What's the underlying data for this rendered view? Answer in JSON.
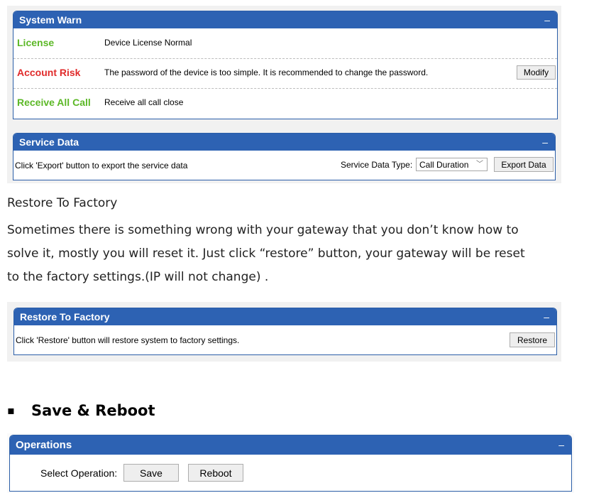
{
  "system_warn": {
    "title": "System Warn",
    "collapse": "–",
    "rows": [
      {
        "label": "License",
        "text": "Device License Normal",
        "color": "#5cb827"
      },
      {
        "label": "Account Risk",
        "text": "The password of the device is too simple. It is recommended to change the password.",
        "color": "#e02b2b",
        "button": "Modify"
      },
      {
        "label": "Receive All Call",
        "text": "Receive all call close",
        "color": "#5cb827"
      }
    ]
  },
  "service_data": {
    "title": "Service Data",
    "collapse": "–",
    "description": "Click 'Export' button to export the service data",
    "type_label": "Service Data Type:",
    "type_value": "Call Duration",
    "export_button": "Export Data"
  },
  "doc": {
    "heading": "Restore To Factory",
    "paragraph_lines": [
      "Sometimes there is something wrong with your gateway that you don’t know how to",
      "solve it, mostly you will reset it. Just click “restore” button, your gateway will be reset",
      "to the factory settings.(IP will not change) ."
    ],
    "section_bullet": "▪",
    "section_title": "Save & Reboot"
  },
  "restore_factory": {
    "title": "Restore To Factory",
    "collapse": "–",
    "description": "Click 'Restore' button will restore system to factory settings.",
    "restore_button": "Restore"
  },
  "operations": {
    "title": "Operations",
    "collapse": "–",
    "select_label": "Select Operation:",
    "save_button": "Save",
    "reboot_button": "Reboot"
  },
  "colors": {
    "header_blue": "#2d62b3",
    "license_green": "#5cb827",
    "risk_red": "#e02b2b"
  }
}
